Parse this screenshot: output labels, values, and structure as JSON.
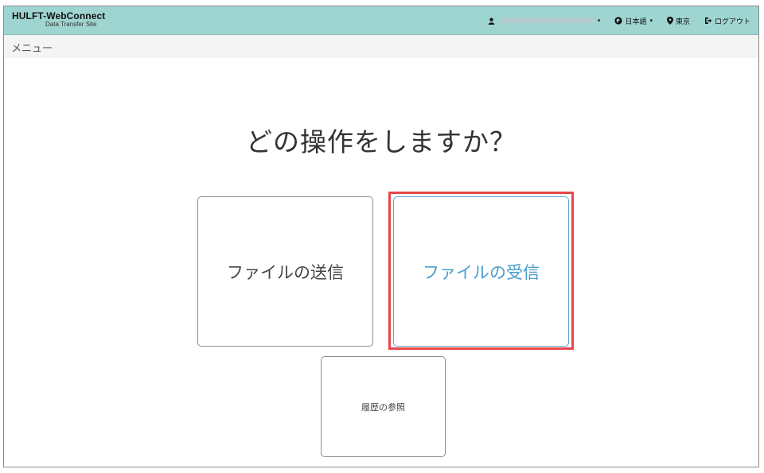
{
  "header": {
    "brand_title": "HULFT-WebConnect",
    "brand_subtitle": "Data Transfer Site",
    "user_label": "",
    "language_label": "日本語",
    "location_label": "東京",
    "logout_label": "ログアウト",
    "bg_color": "#9fd5d1"
  },
  "subbar": {
    "label": "メニュー"
  },
  "main": {
    "question": "どの操作をしますか？",
    "send_label": "ファイルの送信",
    "receive_label": "ファイルの受信",
    "history_label": "履歴の参照",
    "highlight_color": "#e8474a",
    "accent_color": "#4a9bcc"
  },
  "icons": {
    "user": "user-icon",
    "globe": "globe-icon",
    "location": "map-marker-icon",
    "logout": "logout-icon"
  }
}
